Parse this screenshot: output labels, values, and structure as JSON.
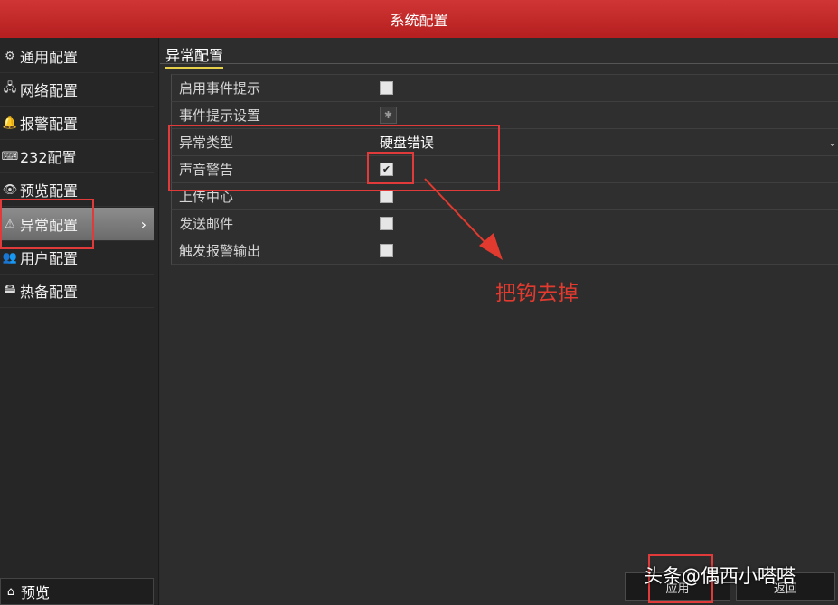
{
  "window": {
    "title": "系统配置"
  },
  "sidebar": {
    "items": [
      {
        "label": "通用配置",
        "icon": "gear-icon",
        "glyph": "⚙"
      },
      {
        "label": "网络配置",
        "icon": "network-icon",
        "glyph": "🖧"
      },
      {
        "label": "报警配置",
        "icon": "alarm-icon",
        "glyph": "🔔"
      },
      {
        "label": "232配置",
        "icon": "serial-port-icon",
        "glyph": "⌨"
      },
      {
        "label": "预览配置",
        "icon": "eye-icon",
        "glyph": "👁"
      },
      {
        "label": "异常配置",
        "icon": "warning-icon",
        "glyph": "⚠",
        "active": true
      },
      {
        "label": "用户配置",
        "icon": "users-icon",
        "glyph": "👥"
      },
      {
        "label": "热备配置",
        "icon": "hot-standby-icon",
        "glyph": "🖴"
      }
    ],
    "active_chevron": "›",
    "preview_label": "预览",
    "preview_glyph": "⌂"
  },
  "main": {
    "tab_label": "异常配置",
    "rows": [
      {
        "label": "启用事件提示",
        "control": "checkbox",
        "checked": false
      },
      {
        "label": "事件提示设置",
        "control": "gear-button",
        "glyph": "✱"
      },
      {
        "label": "异常类型",
        "control": "dropdown",
        "value": "硬盘错误",
        "arrow": "⌄"
      },
      {
        "label": "声音警告",
        "control": "checkbox",
        "checked": true,
        "check_glyph": "✔"
      },
      {
        "label": "上传中心",
        "control": "checkbox",
        "checked": false
      },
      {
        "label": "发送邮件",
        "control": "checkbox",
        "checked": false
      },
      {
        "label": "触发报警输出",
        "control": "checkbox",
        "checked": false
      }
    ]
  },
  "annotation": {
    "text": "把钩去掉",
    "color": "#e23a2f"
  },
  "buttons": {
    "apply": "应用",
    "back": "返回"
  },
  "watermark": "头条@偶西小嗒嗒",
  "colors": {
    "titlebar": "#c22a2a",
    "accent_underline": "#e6d04a",
    "highlight_box": "#e03a3a"
  }
}
